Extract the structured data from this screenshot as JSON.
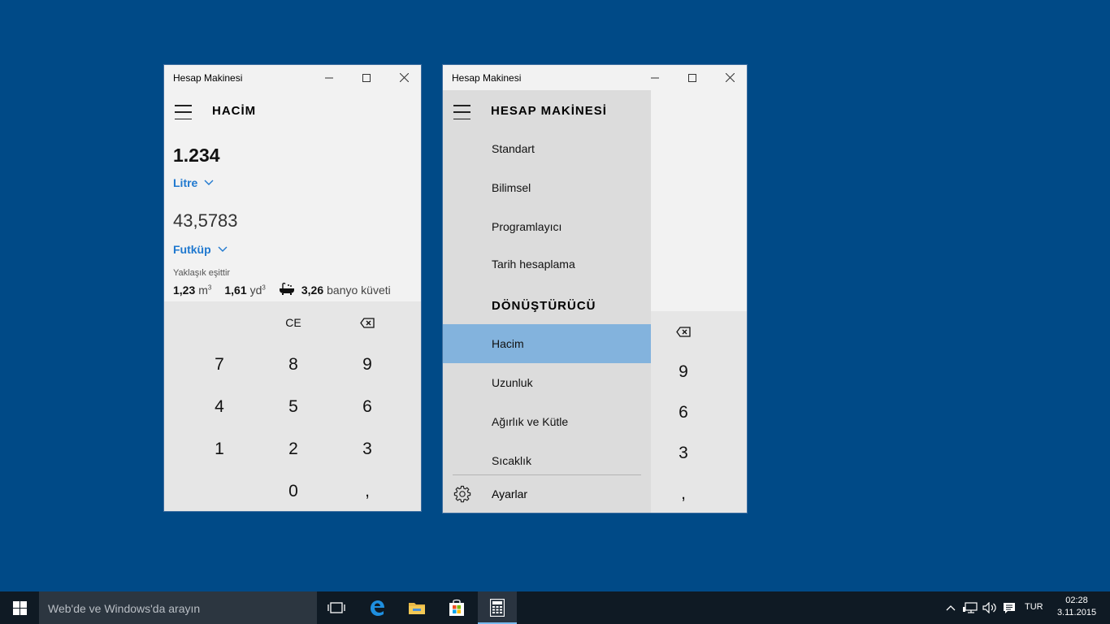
{
  "window1": {
    "title": "Hesap Makinesi",
    "mode_title": "HACİM",
    "input_value": "1.234",
    "input_unit": "Litre",
    "output_value": "43,5783",
    "output_unit": "Futküp",
    "approx_label": "Yaklaşık eşittir",
    "approx": [
      {
        "value": "1,23",
        "unit": "m",
        "exp": "3"
      },
      {
        "value": "1,61",
        "unit": "yd",
        "exp": "3"
      },
      {
        "value": "3,26",
        "unit": "banyo küveti",
        "exp": ""
      }
    ],
    "keys": {
      "ce": "CE",
      "k7": "7",
      "k8": "8",
      "k9": "9",
      "k4": "4",
      "k5": "5",
      "k6": "6",
      "k1": "1",
      "k2": "2",
      "k3": "3",
      "k0": "0",
      "comma": ","
    }
  },
  "window2": {
    "title": "Hesap Makinesi",
    "nav_header": "HESAP MAKİNESİ",
    "calculator_items": [
      "Standart",
      "Bilimsel",
      "Programlayıcı",
      "Tarih hesaplama"
    ],
    "converter_header": "DÖNÜŞTÜRÜCÜ",
    "converter_items": [
      "Hacim",
      "Uzunluk",
      "Ağırlık ve Kütle",
      "Sıcaklık"
    ],
    "selected_item": "Hacim",
    "settings_label": "Ayarlar",
    "right_keys": {
      "k9": "9",
      "k6": "6",
      "k3": "3",
      "comma": ","
    }
  },
  "taskbar": {
    "search_placeholder": "Web'de ve Windows'da arayın",
    "language": "TUR",
    "time": "02:28",
    "date": "3.11.2015",
    "pinned_icons": [
      "task-view-icon",
      "edge-icon",
      "file-explorer-icon",
      "store-icon",
      "calculator-icon"
    ]
  },
  "colors": {
    "desktop": "#004a87",
    "accent": "#1f78cf",
    "selected_nav": "#83b3dd",
    "taskbar": "#0f1a24"
  }
}
